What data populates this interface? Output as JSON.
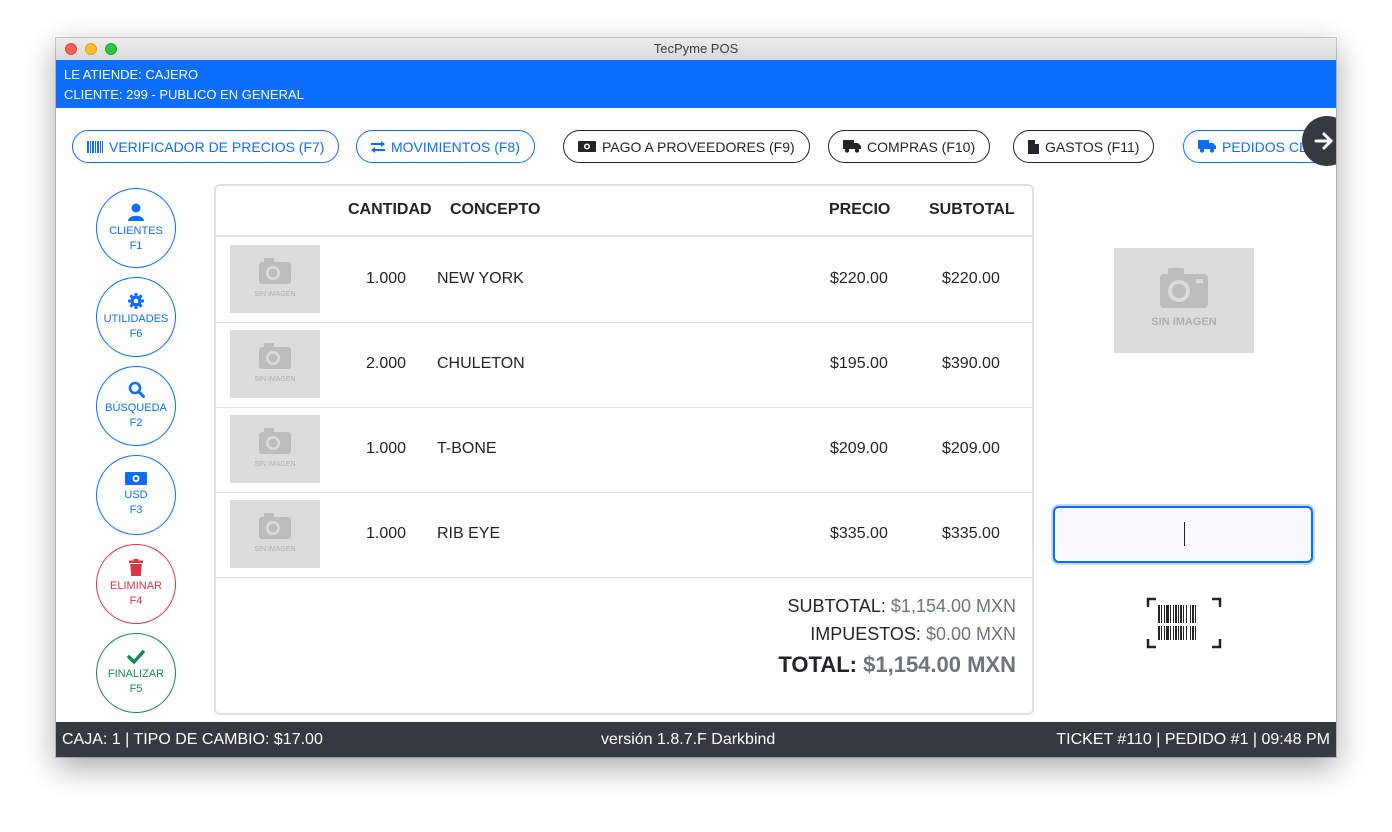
{
  "window": {
    "title": "TecPyme POS"
  },
  "info": {
    "attendant": "LE ATIENDE: CAJERO",
    "client": "CLIENTE: 299 - PUBLICO EN GENERAL"
  },
  "topbar": [
    {
      "label": "VERIFICADOR DE PRECIOS (F7)",
      "icon": "barcode-icon"
    },
    {
      "label": "MOVIMIENTOS (F8)",
      "icon": "exchange-icon"
    },
    {
      "label": "PAGO A PROVEEDORES (F9)",
      "icon": "money-icon"
    },
    {
      "label": "COMPRAS (F10)",
      "icon": "truck-icon"
    },
    {
      "label": "GASTOS (F11)",
      "icon": "file-icon"
    },
    {
      "label": "PEDIDOS CLI",
      "icon": "truck-icon"
    }
  ],
  "sidebar": [
    {
      "label": "CLIENTES",
      "key": "F1",
      "icon": "user-icon"
    },
    {
      "label": "UTILIDADES",
      "key": "F6",
      "icon": "gear-icon"
    },
    {
      "label": "BÚSQUEDA",
      "key": "F2",
      "icon": "search-icon"
    },
    {
      "label": "USD",
      "key": "F3",
      "icon": "money-icon"
    },
    {
      "label": "ELIMINAR",
      "key": "F4",
      "icon": "trash-icon"
    },
    {
      "label": "FINALIZAR",
      "key": "F5",
      "icon": "check-icon"
    }
  ],
  "table": {
    "headers": {
      "qty": "CANTIDAD",
      "concept": "CONCEPTO",
      "price": "PRECIO",
      "subtotal": "SUBTOTAL"
    },
    "no_image": "SIN IMAGEN",
    "rows": [
      {
        "qty": "1.000",
        "concept": "NEW YORK",
        "price": "$220.00",
        "subtotal": "$220.00"
      },
      {
        "qty": "2.000",
        "concept": "CHULETON",
        "price": "$195.00",
        "subtotal": "$390.00"
      },
      {
        "qty": "1.000",
        "concept": "T-BONE",
        "price": "$209.00",
        "subtotal": "$209.00"
      },
      {
        "qty": "1.000",
        "concept": "RIB EYE",
        "price": "$335.00",
        "subtotal": "$335.00"
      }
    ]
  },
  "totals": {
    "subtotal_label": "SUBTOTAL:",
    "subtotal_value": "$1,154.00 MXN",
    "tax_label": "IMPUESTOS:",
    "tax_value": "$0.00 MXN",
    "total_label": "TOTAL:",
    "total_value": "$1,154.00 MXN"
  },
  "preview": {
    "no_image": "SIN IMAGEN"
  },
  "scan_input": {
    "value": ""
  },
  "status": {
    "left": "CAJA: 1 | TIPO DE CAMBIO: $17.00",
    "center": "versión 1.8.7.F Darkbind",
    "right": "TICKET #110 | PEDIDO #1 | 09:48 PM"
  },
  "colors": {
    "primary": "#0d6efd",
    "danger": "#dc3545",
    "success": "#198754",
    "dark": "#343a40"
  }
}
